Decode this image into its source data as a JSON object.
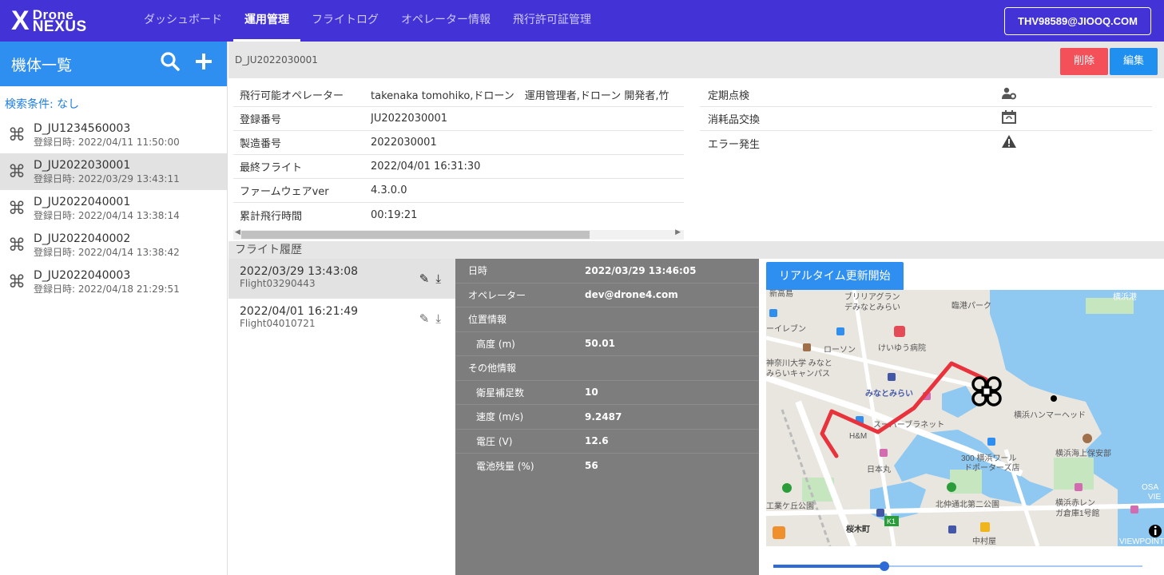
{
  "logo": {
    "x": "X",
    "line1": "Drone",
    "line2": "NEXUS"
  },
  "nav": [
    {
      "label": "ダッシュボード",
      "active": false
    },
    {
      "label": "運用管理",
      "active": true
    },
    {
      "label": "フライトログ",
      "active": false
    },
    {
      "label": "オペレーター情報",
      "active": false
    },
    {
      "label": "飛行許可証管理",
      "active": false
    }
  ],
  "user": "THV98589@JIOOQ.COM",
  "sidebar": {
    "title": "機体一覧",
    "search_icon": "search-icon",
    "add_icon": "plus-icon",
    "filter": "検索条件: なし",
    "items": [
      {
        "name": "D_JU1234560003",
        "date": "登録日時: 2022/04/11 11:50:00"
      },
      {
        "name": "D_JU2022030001",
        "date": "登録日時: 2022/03/29 13:43:11"
      },
      {
        "name": "D_JU2022040001",
        "date": "登録日時: 2022/04/14 13:38:14"
      },
      {
        "name": "D_JU2022040002",
        "date": "登録日時: 2022/04/14 13:38:42"
      },
      {
        "name": "D_JU2022040003",
        "date": "登録日時: 2022/04/18 21:29:51"
      }
    ]
  },
  "header": {
    "drone_id": "D_JU2022030001",
    "delete_label": "削除",
    "edit_label": "編集"
  },
  "info": [
    {
      "label": "飛行可能オペレーター",
      "value": "takenaka tomohiko,ドローン　運用管理者,ドローン 開発者,竹"
    },
    {
      "label": "登録番号",
      "value": "JU2022030001"
    },
    {
      "label": "製造番号",
      "value": "2022030001"
    },
    {
      "label": "最終フライト",
      "value": "2022/04/01 16:31:30"
    },
    {
      "label": "ファームウェアver",
      "value": "4.3.0.0"
    },
    {
      "label": "累計飛行時間",
      "value": "00:19:21"
    }
  ],
  "maintenance": [
    {
      "label": "定期点検",
      "icon": "person-gear-icon",
      "glyph": "👤"
    },
    {
      "label": "消耗品交換",
      "icon": "calendar-sync-icon",
      "glyph": "📅"
    },
    {
      "label": "エラー発生",
      "icon": "warning-icon",
      "glyph": "▲"
    }
  ],
  "history": {
    "title": "フライト履歴",
    "flights": [
      {
        "date": "2022/03/29 13:43:08",
        "name": "Flight03290443"
      },
      {
        "date": "2022/04/01 16:21:49",
        "name": "Flight04010721"
      }
    ]
  },
  "details": [
    {
      "label": "日時",
      "value": "2022/03/29 13:46:05",
      "sub": false
    },
    {
      "label": "オペレーター",
      "value": "dev@drone4.com",
      "sub": false
    },
    {
      "label": "位置情報",
      "value": "",
      "sub": false
    },
    {
      "label": "高度 (m)",
      "value": "50.01",
      "sub": true
    },
    {
      "label": "その他情報",
      "value": "",
      "sub": false
    },
    {
      "label": "衛星補足数",
      "value": "10",
      "sub": true
    },
    {
      "label": "速度 (m/s)",
      "value": "9.2487",
      "sub": true
    },
    {
      "label": "電圧 (V)",
      "value": "12.6",
      "sub": true
    },
    {
      "label": "電池残量 (%)",
      "value": "56",
      "sub": true
    }
  ],
  "map": {
    "realtime_label": "リアルタイム更新開始",
    "labels": {
      "l1": "新高島",
      "l2": "ブリリアグラン",
      "l3": "デみなとみらい",
      "l4": "臨港パーク",
      "l5": "横浜港",
      "l6": "ーイレブン",
      "l7": "ローソン",
      "l8": "けいゆう病院",
      "l9": "神奈川大学 みなと",
      "l10": "みらいキャンパス",
      "l11": "みなとみらい",
      "l12": "スーパーブラネット",
      "l13": "横浜ハンマーヘッド",
      "l14": "H&M",
      "l15": "300 横浜ワール",
      "l16": "ドポーターズ店",
      "l17": "横浜海上保安部",
      "l18": "日本丸",
      "l19": "北仲通北第二公園",
      "l20": "横浜赤レン",
      "l21": "ガ倉庫1号館",
      "l22": "工業ケ丘公園",
      "l23": "桜木町",
      "l24": "K1",
      "l25": "OSA",
      "l26": "VIE",
      "l27": "VIEWPOINT",
      "l28": "中村屋"
    },
    "slider_value": 0.3
  },
  "colors": {
    "nav": "#4333d6",
    "accent": "#2f8ff0",
    "delete": "#f4505a",
    "route": "#e8323c"
  }
}
